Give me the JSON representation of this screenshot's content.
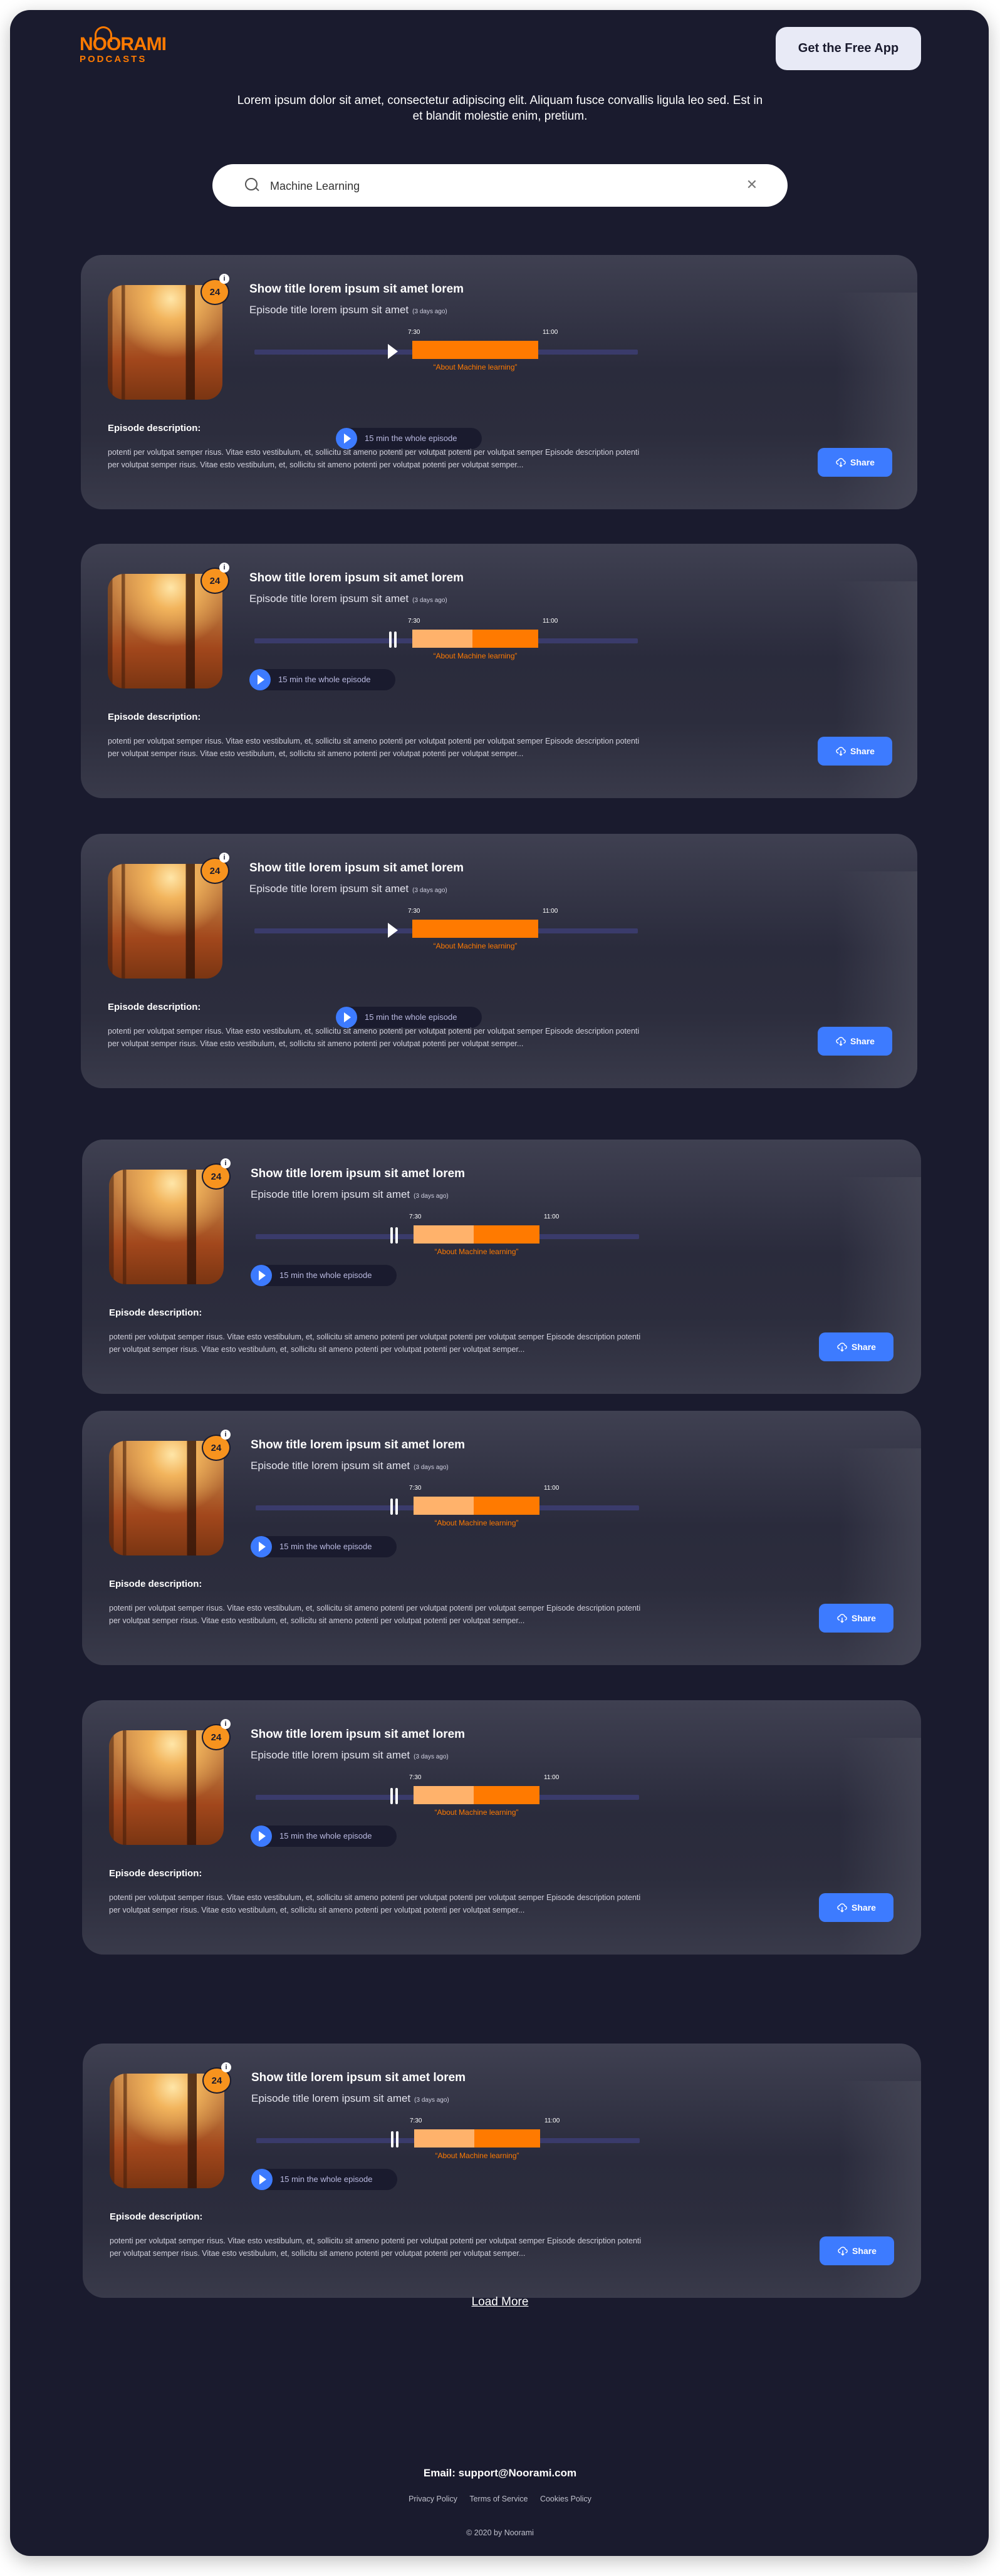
{
  "header": {
    "logo_top": "NOORAMI",
    "logo_bottom": "PODCASTS",
    "app_button": "Get the Free App"
  },
  "intro": "Lorem ipsum dolor sit amet, consectetur adipiscing elit. Aliquam fusce convallis ligula leo sed. Est in et blandit molestie enim, pretium.",
  "search": {
    "value": "Machine Learning",
    "icon": "search-icon",
    "clear_icon": "close-icon"
  },
  "colors": {
    "background": "#1A1B2E",
    "accent": "#FF7A00",
    "accent_light": "#FFB26B",
    "button": "#3D7BFF",
    "track": "#3A3B6B"
  },
  "episodes": [
    {
      "badge": "24",
      "show_title": "Show title lorem ipsum sit amet lorem",
      "episode_title": "Episode title lorem ipsum sit amet",
      "age": "(3 days ago)",
      "start": "7:30",
      "end": "11:00",
      "segment_label": "“About Machine learning”",
      "state": "paused",
      "segment_progress": 0,
      "whole_episode": "15 min the whole episode",
      "desc_heading": "Episode description:",
      "description": "potenti per volutpat semper risus. Vitae esto vestibulum, et, sollicitu sit ameno potenti per volutpat potenti per volutpat semper Episode description potenti per volutpat semper risus. Vitae esto vestibulum, et, sollicitu sit ameno potenti per volutpat potenti per volutpat semper...",
      "share": "Share"
    },
    {
      "badge": "24",
      "show_title": "Show title lorem ipsum sit amet lorem",
      "episode_title": "Episode title lorem ipsum sit amet",
      "age": "(3 days ago)",
      "start": "7:30",
      "end": "11:00",
      "segment_label": "“About Machine learning”",
      "state": "playing",
      "segment_progress": 0.48,
      "whole_episode": "15 min the whole episode",
      "desc_heading": "Episode description:",
      "description": "potenti per volutpat semper risus. Vitae esto vestibulum, et, sollicitu sit ameno potenti per volutpat potenti per volutpat semper Episode description potenti per volutpat semper risus. Vitae esto vestibulum, et, sollicitu sit ameno potenti per volutpat potenti per volutpat semper...",
      "share": "Share"
    },
    {
      "badge": "24",
      "show_title": "Show title lorem ipsum sit amet lorem",
      "episode_title": "Episode title lorem ipsum sit amet",
      "age": "(3 days ago)",
      "start": "7:30",
      "end": "11:00",
      "segment_label": "“About Machine learning”",
      "state": "paused",
      "segment_progress": 0,
      "whole_episode": "15 min the whole episode",
      "desc_heading": "Episode description:",
      "description": "potenti per volutpat semper risus. Vitae esto vestibulum, et, sollicitu sit ameno potenti per volutpat potenti per volutpat semper Episode description potenti per volutpat semper risus. Vitae esto vestibulum, et, sollicitu sit ameno potenti per volutpat potenti per volutpat semper...",
      "share": "Share"
    },
    {
      "badge": "24",
      "show_title": "Show title lorem ipsum sit amet lorem",
      "episode_title": "Episode title lorem ipsum sit amet",
      "age": "(3 days ago)",
      "start": "7:30",
      "end": "11:00",
      "segment_label": "“About Machine learning”",
      "state": "playing",
      "segment_progress": 0.48,
      "whole_episode": "15 min the whole episode",
      "desc_heading": "Episode description:",
      "description": "potenti per volutpat semper risus. Vitae esto vestibulum, et, sollicitu sit ameno potenti per volutpat potenti per volutpat semper Episode description potenti per volutpat semper risus. Vitae esto vestibulum, et, sollicitu sit ameno potenti per volutpat potenti per volutpat semper...",
      "share": "Share"
    },
    {
      "badge": "24",
      "show_title": "Show title lorem ipsum sit amet lorem",
      "episode_title": "Episode title lorem ipsum sit amet",
      "age": "(3 days ago)",
      "start": "7:30",
      "end": "11:00",
      "segment_label": "“About Machine learning”",
      "state": "playing",
      "segment_progress": 0.48,
      "whole_episode": "15 min the whole episode",
      "desc_heading": "Episode description:",
      "description": "potenti per volutpat semper risus. Vitae esto vestibulum, et, sollicitu sit ameno potenti per volutpat potenti per volutpat semper Episode description potenti per volutpat semper risus. Vitae esto vestibulum, et, sollicitu sit ameno potenti per volutpat potenti per volutpat semper...",
      "share": "Share"
    },
    {
      "badge": "24",
      "show_title": "Show title lorem ipsum sit amet lorem",
      "episode_title": "Episode title lorem ipsum sit amet",
      "age": "(3 days ago)",
      "start": "7:30",
      "end": "11:00",
      "segment_label": "“About Machine learning”",
      "state": "playing",
      "segment_progress": 0.48,
      "whole_episode": "15 min the whole episode",
      "desc_heading": "Episode description:",
      "description": "potenti per volutpat semper risus. Vitae esto vestibulum, et, sollicitu sit ameno potenti per volutpat potenti per volutpat semper Episode description potenti per volutpat semper risus. Vitae esto vestibulum, et, sollicitu sit ameno potenti per volutpat potenti per volutpat semper...",
      "share": "Share"
    },
    {
      "badge": "24",
      "show_title": "Show title lorem ipsum sit amet lorem",
      "episode_title": "Episode title lorem ipsum sit amet",
      "age": "(3 days ago)",
      "start": "7:30",
      "end": "11:00",
      "segment_label": "“About Machine learning”",
      "state": "playing",
      "segment_progress": 0.48,
      "whole_episode": "15 min the whole episode",
      "desc_heading": "Episode description:",
      "description": "potenti per volutpat semper risus. Vitae esto vestibulum, et, sollicitu sit ameno potenti per volutpat potenti per volutpat semper Episode description potenti per volutpat semper risus. Vitae esto vestibulum, et, sollicitu sit ameno potenti per volutpat potenti per volutpat semper...",
      "share": "Share"
    }
  ],
  "load_more": "Load More",
  "footer": {
    "email": "Email: support@Noorami.com",
    "links": [
      "Privacy Policy",
      "Terms of Service",
      "Cookies Policy"
    ],
    "copyright": "© 2020 by Noorami"
  }
}
